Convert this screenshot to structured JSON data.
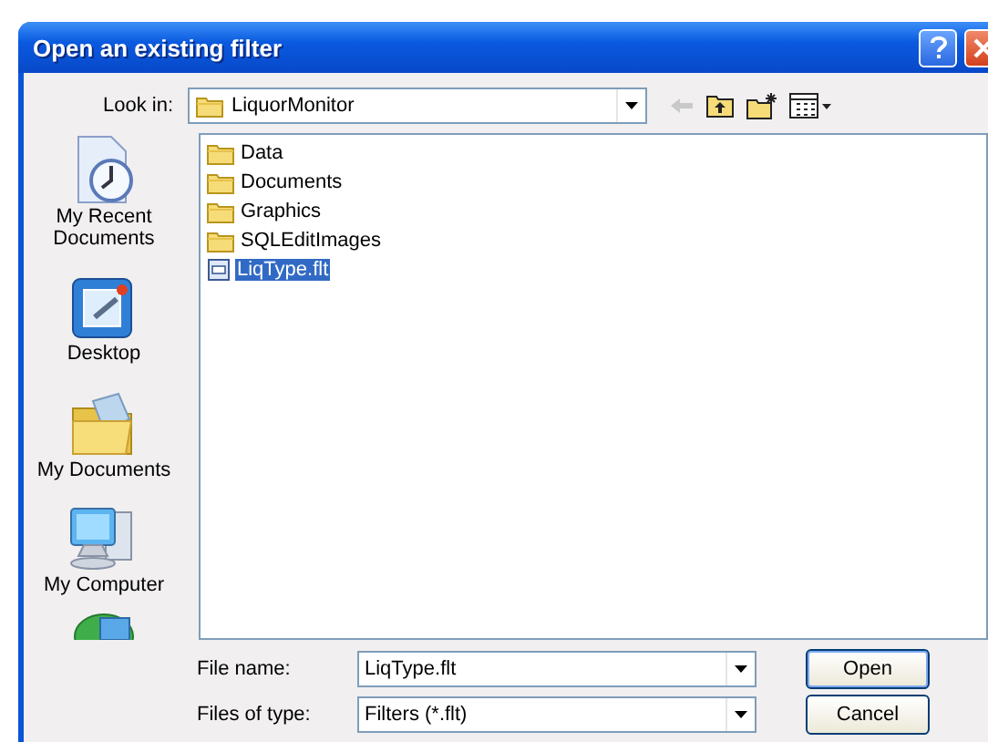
{
  "window": {
    "title": "Open an existing filter"
  },
  "look_in": {
    "label": "Look in:",
    "value": "LiquorMonitor"
  },
  "places": [
    {
      "label": "My Recent Documents",
      "kind": "recent"
    },
    {
      "label": "Desktop",
      "kind": "desktop"
    },
    {
      "label": "My Documents",
      "kind": "documents"
    },
    {
      "label": "My Computer",
      "kind": "computer"
    },
    {
      "kind": "network"
    }
  ],
  "files": [
    {
      "name": "Data",
      "kind": "folder",
      "selected": false
    },
    {
      "name": "Documents",
      "kind": "folder",
      "selected": false
    },
    {
      "name": "Graphics",
      "kind": "folder",
      "selected": false
    },
    {
      "name": "SQLEditImages",
      "kind": "folder",
      "selected": false
    },
    {
      "name": "LiqType.flt",
      "kind": "file",
      "selected": true
    }
  ],
  "file_name": {
    "label": "File name:",
    "value": "LiqType.flt"
  },
  "file_type": {
    "label": "Files of type:",
    "value": "Filters (*.flt)"
  },
  "buttons": [
    {
      "label": "Open",
      "default": true
    },
    {
      "label": "Cancel",
      "default": false
    }
  ]
}
